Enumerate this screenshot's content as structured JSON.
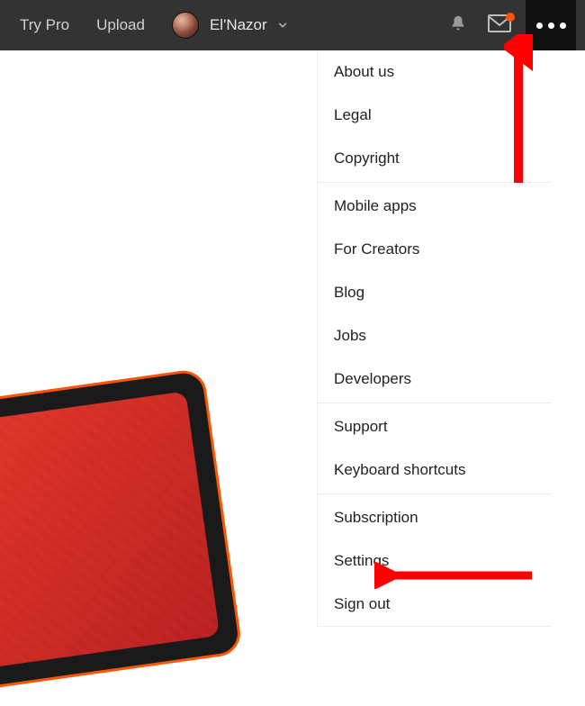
{
  "topbar": {
    "try_pro": "Try Pro",
    "upload": "Upload",
    "username": "El'Nazor"
  },
  "menu": {
    "groups": [
      {
        "items": [
          "About us",
          "Legal",
          "Copyright"
        ]
      },
      {
        "items": [
          "Mobile apps",
          "For Creators",
          "Blog",
          "Jobs",
          "Developers"
        ]
      },
      {
        "items": [
          "Support",
          "Keyboard shortcuts"
        ]
      },
      {
        "items": [
          "Subscription",
          "Settings",
          "Sign out"
        ]
      }
    ]
  },
  "colors": {
    "accent": "#ff5500",
    "arrow": "#ff0000"
  }
}
